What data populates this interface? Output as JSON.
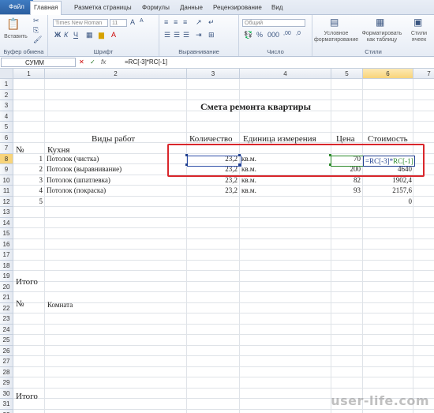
{
  "tabs": [
    "Файл",
    "Главная",
    "Разметка страницы",
    "Формулы",
    "Данные",
    "Рецензирование",
    "Вид"
  ],
  "ribbon": {
    "paste_label": "Вставить",
    "clipboard_label": "Буфер обмена",
    "font_name": "Times New Roman",
    "font_size": "11",
    "font_label": "Шрифт",
    "align_label": "Выравнивание",
    "number_format": "Общий",
    "number_label": "Число",
    "cond_format_label": "Условное форматирование",
    "format_table_label": "Форматировать как таблицу",
    "cell_styles_label": "Стили ячеек",
    "styles_label": "Стили"
  },
  "formula_bar": {
    "name_box": "СУММ",
    "fx": "fx",
    "formula": "=RC[-3]*RC[-1]"
  },
  "columns": [
    "1",
    "2",
    "3",
    "4",
    "5",
    "6",
    "7"
  ],
  "rows": [
    "1",
    "2",
    "3",
    "4",
    "5",
    "6",
    "7",
    "8",
    "9",
    "10",
    "11",
    "12",
    "13",
    "14",
    "15",
    "16",
    "17",
    "18",
    "19",
    "20",
    "21",
    "22",
    "23",
    "24",
    "25",
    "26",
    "27",
    "28",
    "29",
    "30",
    "31",
    "32"
  ],
  "sheet": {
    "title": "Смета ремонта квартиры",
    "headers": {
      "works": "Виды работ",
      "qty": "Количество",
      "unit": "Единица измерения",
      "price": "Цена",
      "cost": "Стоимость"
    },
    "num_sign": "№",
    "kitchen": "Кухня",
    "items": [
      {
        "n": "1",
        "name": "Потолок (чистка)",
        "qty": "23,2",
        "unit": "кв.м.",
        "price": "70",
        "cost": ""
      },
      {
        "n": "2",
        "name": "Потолок (выравнивание)",
        "qty": "23,2",
        "unit": "кв.м.",
        "price": "200",
        "cost": "4640"
      },
      {
        "n": "3",
        "name": "Потолок (шпатлевка)",
        "qty": "23,2",
        "unit": "кв.м.",
        "price": "82",
        "cost": "1902,4"
      },
      {
        "n": "4",
        "name": "Потолок (покраска)",
        "qty": "23,2",
        "unit": "кв.м.",
        "price": "93",
        "cost": "2157,6"
      },
      {
        "n": "5",
        "name": "",
        "qty": "",
        "unit": "",
        "price": "",
        "cost": "0"
      }
    ],
    "edit_formula_a": "=RC[-3]*",
    "edit_formula_b": "RC[-1]",
    "total1": "Итого",
    "num_sign2": "№",
    "room": "Комната",
    "total2": "Итого"
  },
  "watermark": "user-life.com"
}
